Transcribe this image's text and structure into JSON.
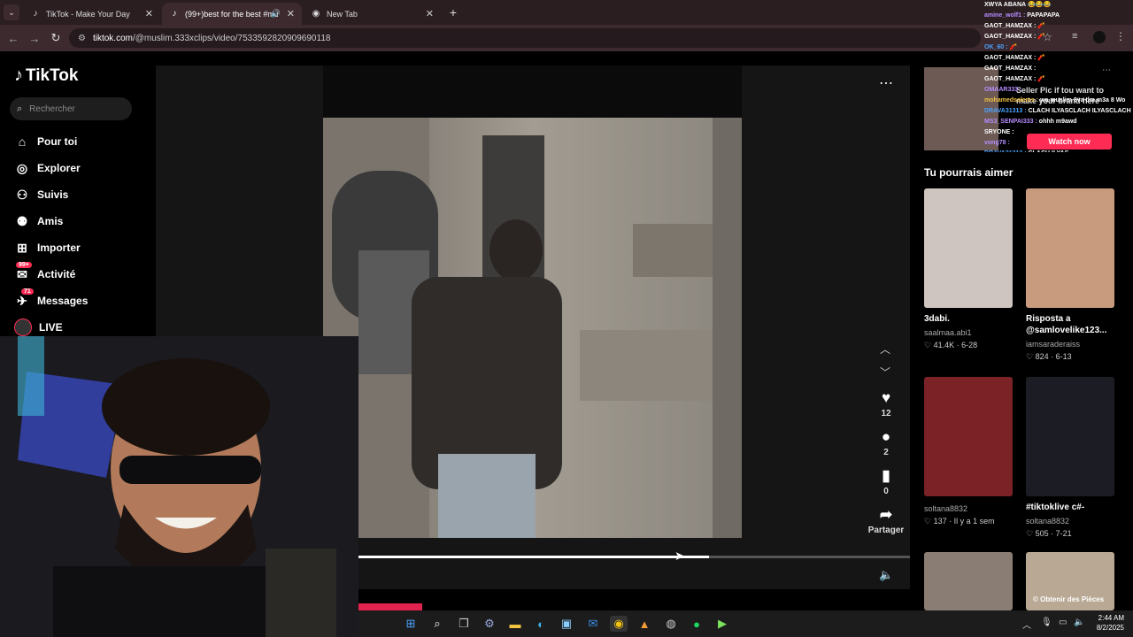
{
  "browser": {
    "tabs": [
      {
        "title": "TikTok - Make Your Day",
        "icon": "tiktok-icon",
        "active": false
      },
      {
        "title": "(99+)best for the best #mu",
        "icon": "tiktok-icon",
        "active": true
      },
      {
        "title": "New Tab",
        "icon": "chrome-icon",
        "active": false
      }
    ],
    "url_host": "tiktok.com",
    "url_path": "/@muslim.333xclips/video/7533592820909690118"
  },
  "sidebar": {
    "logo": "TikTok",
    "search_placeholder": "Rechercher",
    "items": [
      {
        "label": "Pour toi",
        "icon": "home-icon"
      },
      {
        "label": "Explorer",
        "icon": "compass-icon"
      },
      {
        "label": "Suivis",
        "icon": "following-icon"
      },
      {
        "label": "Amis",
        "icon": "friends-icon"
      },
      {
        "label": "Importer",
        "icon": "upload-icon"
      },
      {
        "label": "Activité",
        "icon": "activity-icon",
        "badge": "99+"
      },
      {
        "label": "Messages",
        "icon": "messages-icon",
        "badge": "71"
      },
      {
        "label": "LIVE",
        "icon": "live-avatar-icon"
      }
    ]
  },
  "player": {
    "likes": "12",
    "comments": "2",
    "saves": "0",
    "share_label": "Partager",
    "progress": 0.636
  },
  "live_promo": {
    "text": "Seller Pic if tou want to make your brand here",
    "button": "Watch now"
  },
  "suggestions": {
    "title": "Tu pourrais aimer",
    "cards": [
      {
        "title": "3dabi.",
        "author": "saalmaa.abi1",
        "likes": "41.4K",
        "date": "6-28",
        "thumb_caption": ""
      },
      {
        "title": "Risposta a @samlovelike123...",
        "author": "iamsaraderaiss",
        "likes": "824",
        "date": "6-13",
        "thumb_caption": ""
      },
      {
        "title": "",
        "author": "soltana8832",
        "likes": "137",
        "date": "Il y a 1 sem",
        "thumb_caption": ""
      },
      {
        "title": "#tiktoklive c#-",
        "author": "soltana8832",
        "likes": "505",
        "date": "7-21",
        "thumb_caption": ""
      },
      {
        "title": "",
        "author": "",
        "likes": "",
        "date": "",
        "thumb_caption": ""
      },
      {
        "title": "",
        "author": "",
        "likes": "",
        "date": "",
        "thumb_caption": "Obtenir des Pièces"
      }
    ]
  },
  "chat": [
    {
      "user": "XWYA ABANA",
      "msg": "😂😂😂",
      "color": "#ffffff"
    },
    {
      "user": "amine_wolf1 :",
      "msg": "PAPAPAPA",
      "color": "#b58cff"
    },
    {
      "user": "GAOT_HAMZAX :",
      "msg": "🧨",
      "color": "#ffffff"
    },
    {
      "user": "GAOT_HAMZAX :",
      "msg": "🧨",
      "color": "#ffffff"
    },
    {
      "user": "OK_60 :",
      "msg": "🧨",
      "color": "#4aa3ff"
    },
    {
      "user": "GAOT_HAMZAX :",
      "msg": "🧨",
      "color": "#ffffff"
    },
    {
      "user": "GAOT_HAMZAX :",
      "msg": "",
      "color": "#ffffff"
    },
    {
      "user": "GAOT_HAMZAX :",
      "msg": "🧨",
      "color": "#ffffff"
    },
    {
      "user": "OMAAR333 :",
      "msg": "",
      "color": "#b58cff"
    },
    {
      "user": "mohamedsalems :",
      "msg": "wa muslim 8va tlm m3a 8 Wo",
      "color": "#f0c040"
    },
    {
      "user": "DRAVA31313 :",
      "msg": "CLACH ILYASCLACH ILYASCLACH ILYAS",
      "color": "#4aa3ff"
    },
    {
      "user": "MS3_SENPAI333 :",
      "msg": "ohhh m9awd",
      "color": "#b58cff"
    },
    {
      "user": "SRYONE :",
      "msg": "",
      "color": "#ffffff"
    },
    {
      "user": "vong78 :",
      "msg": "",
      "color": "#b58cff"
    },
    {
      "user": "DRAVA31313 :",
      "msg": "CLACH ILYAS",
      "color": "#4aa3ff"
    }
  ],
  "taskbar": {
    "time": "2:44 AM",
    "date": "8/2/2025"
  },
  "colors": {
    "accent": "#fe2c55",
    "browser_frame": "#2a1e21",
    "toolbar": "#3c2a2f"
  }
}
